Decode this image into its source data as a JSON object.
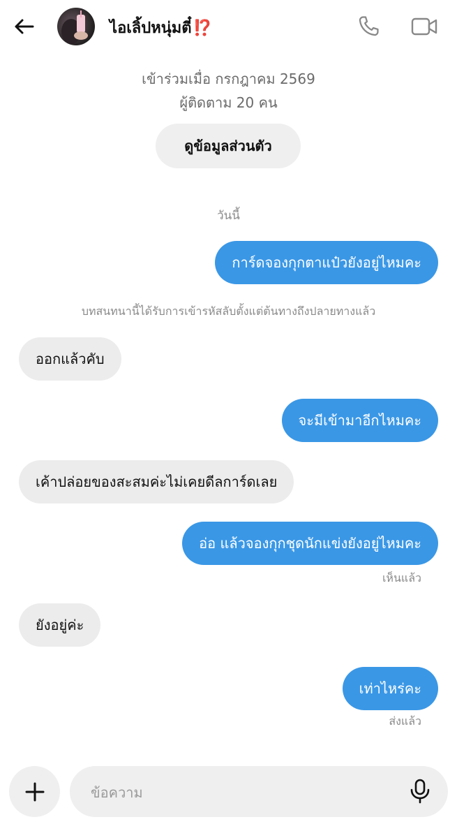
{
  "header": {
    "contact_name": "ไอเลิ้ปหนุ่มตี๋",
    "name_badge": "⁉️",
    "icons": {
      "back": "back-arrow-icon",
      "call": "phone-icon",
      "video": "video-camera-icon"
    }
  },
  "profile": {
    "joined": "เข้าร่วมเมื่อ กรกฎาคม 2569",
    "followers": "ผู้ติดตาม 20 คน",
    "view_profile_label": "ดูข้อมูลส่วนตัว"
  },
  "conversation": {
    "day_label": "วันนี้",
    "encryption_note": "บทสนทนานี้ได้รับการเข้ารหัสลับตั้งแต่ต้นทางถึงปลายทางแล้ว",
    "messages": [
      {
        "from": "me",
        "text": "การ์ดจองกุกตาแป๋วยังอยู่ไหมคะ"
      },
      {
        "from": "them",
        "text": "ออกแล้วคับ"
      },
      {
        "from": "me",
        "text": "จะมีเข้ามาอีกไหมคะ"
      },
      {
        "from": "them",
        "text": "เค้าปล่อยของสะสมค่ะไม่เคยดีลการ์ดเลย"
      },
      {
        "from": "me",
        "text": "อ่อ แล้วจองกุกชุดนักแข่งยังอยู่ไหมคะ",
        "status": "เห็นแล้ว"
      },
      {
        "from": "them",
        "text": "ยังอยู่ค่ะ"
      },
      {
        "from": "me",
        "text": "เท่าไหร่คะ",
        "status": "ส่งแล้ว"
      }
    ]
  },
  "composer": {
    "placeholder": "ข้อความ",
    "value": "",
    "icons": {
      "add": "plus-icon",
      "mic": "microphone-icon"
    }
  },
  "colors": {
    "outgoing_bubble": "#3a97e6",
    "incoming_bubble": "#ececec",
    "muted_text": "#8a8a8a"
  }
}
